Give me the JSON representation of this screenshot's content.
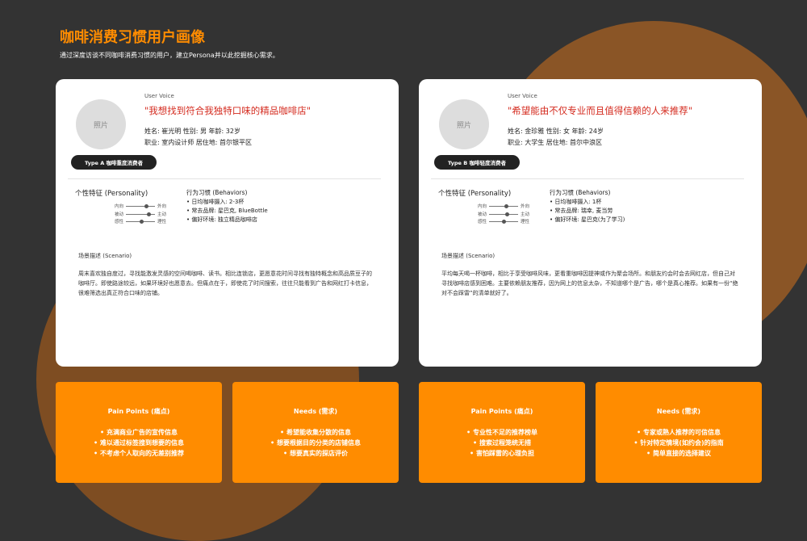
{
  "page": {
    "title": "咖啡消费习惯用户画像",
    "subtitle": "通过深度访谈不同咖啡消费习惯的用户，建立Persona并以此挖掘核心需求。"
  },
  "personas": [
    {
      "photo_label": "照片",
      "user_voice_label": "User Voice",
      "quote": "\"我想找到符合我独特口味的精品咖啡店\"",
      "line1": "姓名: 崔光明   性别: 男   年龄: 32岁",
      "line2": "职业: 室内设计师   居住地: 首尔银平区",
      "type_badge": "Type A 咖啡重度消费者",
      "personality_title": "个性特征 (Personality)",
      "sliders": [
        {
          "left": "内向",
          "right": "外向",
          "value": 0.75
        },
        {
          "left": "被动",
          "right": "主动",
          "value": 0.85
        },
        {
          "left": "感性",
          "right": "理性",
          "value": 0.55
        }
      ],
      "behaviors_title": "行为习惯 (Behaviors)",
      "behaviors": [
        "• 日均咖啡摄入: 2-3杯",
        "• 常去品牌: 星巴克, BlueBottle",
        "• 偏好环境: 独立精品咖啡店"
      ],
      "scenario_title": "场景描述 (Scenario)",
      "scenario": "周末喜欢独自度过，寻找能激发灵感的空间喝咖啡、读书。相比连锁店，更愿意花时间寻找有独特概念和高品质豆子的咖啡厅。即使路途较远，如果环境好也愿意去。但痛点在于，即使花了时间搜索，往往只能看到广告和网红打卡信息，很难筛选出真正符合口味的店铺。",
      "pain_title": "Pain Points (痛点)",
      "pain_items": [
        "• 充满商业广告的宣传信息",
        "• 难以通过标签搜到想要的信息",
        "• 不考虑个人取向的无差别推荐"
      ],
      "needs_title": "Needs (需求)",
      "needs_items": [
        "• 希望能收集分散的信息",
        "• 想要根据目的分类的店铺信息",
        "• 想要真实的探店评价"
      ]
    },
    {
      "photo_label": "照片",
      "user_voice_label": "User Voice",
      "quote": "\"希望能由不仅专业而且值得信赖的人来推荐\"",
      "line1": "姓名: 金珍雅   性别: 女   年龄: 24岁",
      "line2": "职业: 大学生   居住地: 首尔中浪区",
      "type_badge": "Type B 咖啡轻度消费者",
      "personality_title": "个性特征 (Personality)",
      "sliders": [
        {
          "left": "内向",
          "right": "外向",
          "value": 0.6
        },
        {
          "left": "被动",
          "right": "主动",
          "value": 0.65
        },
        {
          "left": "感性",
          "right": "理性",
          "value": 0.5
        }
      ],
      "behaviors_title": "行为习惯 (Behaviors)",
      "behaviors": [
        "• 日均咖啡摄入: 1杯",
        "• 常去品牌: 瑞幸, 麦当劳",
        "• 偏好环境: 星巴克(为了学习)"
      ],
      "scenario_title": "场景描述 (Scenario)",
      "scenario": "平均每天喝一杯咖啡，相比于享受咖啡风味，更看重咖啡因提神或作为聚会场所。和朋友约会时会去网红店，但自己对寻找咖啡店感到困难。主要依赖朋友推荐，因为网上的信息太杂，不知道哪个是广告，哪个是真心推荐。如果有一份“绝对不会踩雷”的清单就好了。",
      "pain_title": "Pain Points (痛点)",
      "pain_items": [
        "• 专业性不足的推荐榜单",
        "• 搜索过程笼统无措",
        "• 害怕踩雷的心理负担"
      ],
      "needs_title": "Needs (需求)",
      "needs_items": [
        "• 专家或熟人推荐的可信信息",
        "• 针对特定情境(如约会)的指南",
        "• 简单直接的选择建议"
      ]
    }
  ],
  "colors": {
    "background": "#333333",
    "accent": "#ff8c00",
    "quote": "#d42a1e",
    "circle": "#8a5526"
  }
}
